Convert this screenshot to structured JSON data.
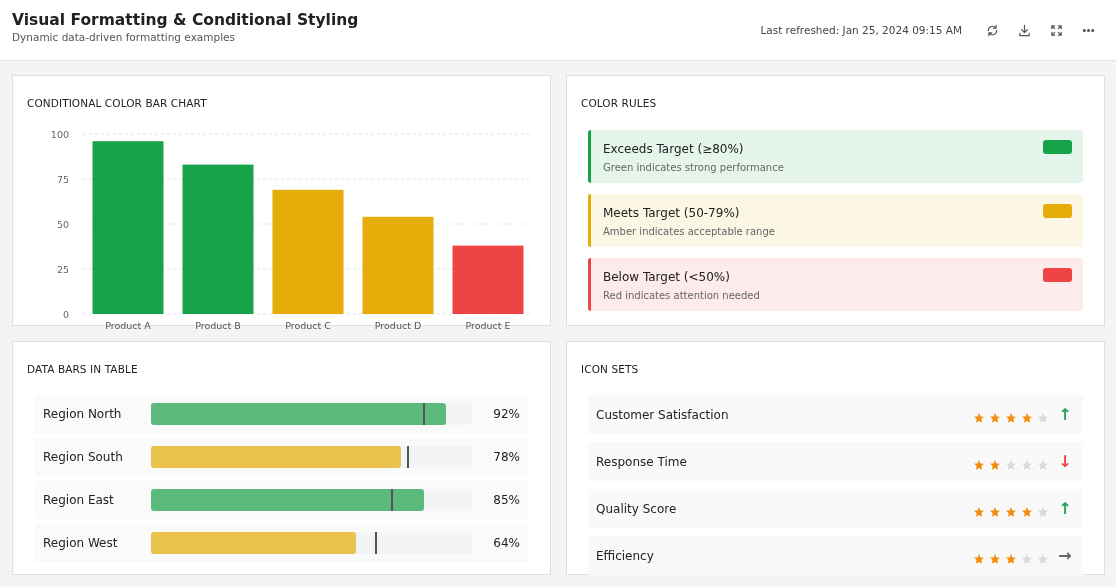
{
  "header": {
    "title": "Visual Formatting & Conditional Styling",
    "subtitle": "Dynamic data-driven formatting examples",
    "last_refreshed": "Last refreshed: Jan 25, 2024 09:15 AM",
    "actions": [
      {
        "kind": "refresh"
      },
      {
        "kind": "download"
      },
      {
        "kind": "expand"
      },
      {
        "kind": "more"
      }
    ]
  },
  "bar_chart": {
    "title": "CONDITIONAL COLOR BAR CHART",
    "chart_data": {
      "type": "bar",
      "categories": [
        "Product A",
        "Product B",
        "Product C",
        "Product D",
        "Product E"
      ],
      "grid": true,
      "ylim": [
        0,
        100
      ],
      "yticks": [
        0,
        25,
        50,
        75,
        100
      ],
      "series": [
        {
          "color": "#16a34a",
          "values": [
            96,
            83,
            null,
            null,
            null
          ]
        },
        {
          "color": "#e5ac0a",
          "values": [
            null,
            null,
            69,
            54,
            null
          ]
        },
        {
          "color": "#ef4444",
          "values": [
            null,
            null,
            null,
            null,
            38
          ]
        }
      ]
    }
  },
  "color_rules": {
    "title": "COLOR RULES",
    "rules": [
      {
        "label": "Exceeds Target (≥80%)",
        "description": "Green indicates strong performance",
        "color": "#16a34a"
      },
      {
        "label": "Meets Target (50-79%)",
        "description": "Amber indicates acceptable range",
        "color": "#e5ac0a"
      },
      {
        "label": "Below Target (<50%)",
        "description": "Red indicates attention needed",
        "color": "#ef4444"
      }
    ]
  },
  "data_bars": {
    "title": "DATA BARS IN TABLE",
    "rows": [
      {
        "region": "Region North",
        "level": 0.92,
        "target": {
          "level": 0.85
        },
        "color": "#5ab97b",
        "value": "92%"
      },
      {
        "region": "Region South",
        "level": 0.78,
        "target": {
          "level": 0.8
        },
        "color": "#e9c34b",
        "value": "78%"
      },
      {
        "region": "Region East",
        "level": 0.85,
        "target": {
          "level": 0.75
        },
        "color": "#5ab97b",
        "value": "85%"
      },
      {
        "region": "Region West",
        "level": 0.64,
        "target": {
          "level": 0.7
        },
        "color": "#e9c34b",
        "value": "64%"
      }
    ]
  },
  "icon_sets": {
    "title": "ICON SETS",
    "rows": [
      {
        "label": "Customer Satisfaction",
        "stars": 4,
        "arrow": "↑",
        "color": "#22a55a"
      },
      {
        "label": "Response Time",
        "stars": 2,
        "arrow": "↓",
        "color": "#ef4444"
      },
      {
        "label": "Quality Score",
        "stars": 4,
        "arrow": "↑",
        "color": "#22a55a"
      },
      {
        "label": "Efficiency",
        "stars": 3,
        "arrow": "→",
        "color": "#666666"
      }
    ]
  }
}
